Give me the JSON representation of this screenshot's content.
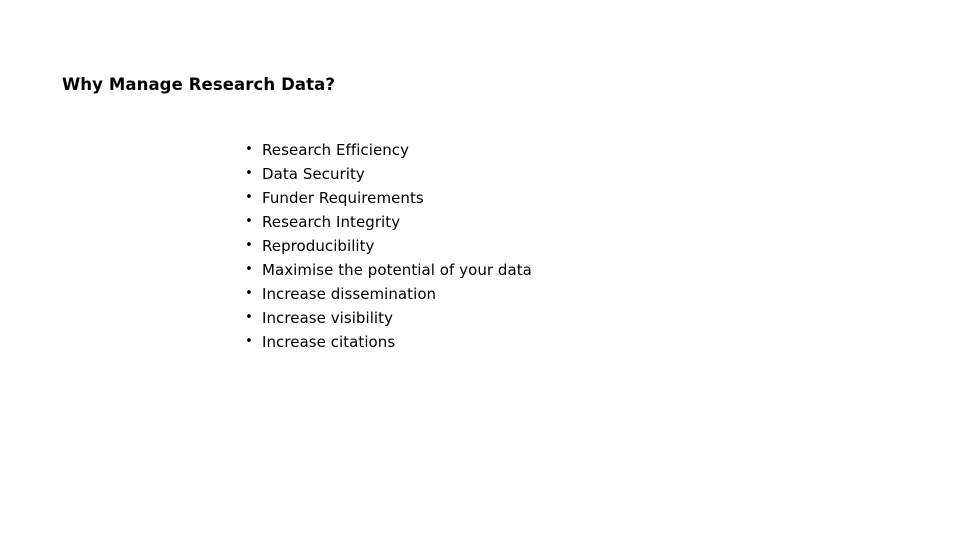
{
  "slide": {
    "title": "Why Manage Research Data?",
    "background_color": "#ffffff",
    "text_color": "#000000",
    "bullet_glyph": "•",
    "bullets": [
      {
        "label": "Research Efficiency"
      },
      {
        "label": "Data Security"
      },
      {
        "label": "Funder Requirements"
      },
      {
        "label": "Research Integrity"
      },
      {
        "label": "Reproducibility"
      },
      {
        "label": "Maximise the potential of your data"
      },
      {
        "label": "Increase dissemination"
      },
      {
        "label": "Increase visibility"
      },
      {
        "label": "Increase citations"
      }
    ]
  }
}
